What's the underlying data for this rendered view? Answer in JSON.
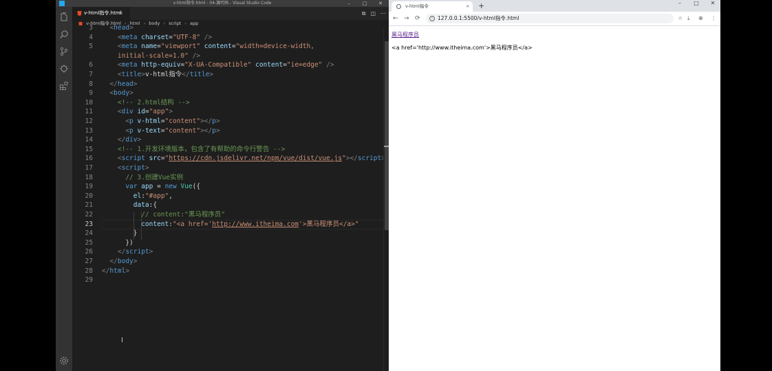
{
  "vscode": {
    "window_title": "v-html指令.html - 04-源代码 - Visual Studio Code",
    "window_controls": [
      "–",
      "□",
      "✕"
    ],
    "activity_icons": [
      "explorer-icon",
      "search-icon",
      "source-control-icon",
      "debug-icon",
      "extensions-icon"
    ],
    "settings_icon": "gear-icon",
    "tab": {
      "name": "v-html指令.html",
      "close": "×"
    },
    "tab_actions": [
      "⧉",
      "◫",
      "⋯"
    ],
    "breadcrumb": [
      "v-html指令.html",
      "html",
      "body",
      "script",
      "app"
    ],
    "breadcrumb_sep": "›",
    "lines": [
      {
        "n": "3",
        "tokens": [
          [
            "t-punct",
            "  <"
          ],
          [
            "t-tag",
            "head"
          ],
          [
            "t-punct",
            ">"
          ]
        ]
      },
      {
        "n": "4",
        "tokens": [
          [
            "t-punct",
            "    <"
          ],
          [
            "t-tag",
            "meta"
          ],
          [
            "t-text",
            " "
          ],
          [
            "t-attr",
            "charset"
          ],
          [
            "t-text",
            "="
          ],
          [
            "t-str",
            "\"UTF-8\""
          ],
          [
            "t-text",
            " "
          ],
          [
            "t-punct",
            "/>"
          ]
        ]
      },
      {
        "n": "5",
        "tokens": [
          [
            "t-punct",
            "    <"
          ],
          [
            "t-tag",
            "meta"
          ],
          [
            "t-text",
            " "
          ],
          [
            "t-attr",
            "name"
          ],
          [
            "t-text",
            "="
          ],
          [
            "t-str",
            "\"viewport\""
          ],
          [
            "t-text",
            " "
          ],
          [
            "t-attr",
            "content"
          ],
          [
            "t-text",
            "="
          ],
          [
            "t-str",
            "\"width=device-width,"
          ]
        ]
      },
      {
        "n": "",
        "tokens": [
          [
            "t-str",
            "    initial-scale=1.0\""
          ],
          [
            "t-text",
            " "
          ],
          [
            "t-punct",
            "/>"
          ]
        ]
      },
      {
        "n": "6",
        "tokens": [
          [
            "t-punct",
            "    <"
          ],
          [
            "t-tag",
            "meta"
          ],
          [
            "t-text",
            " "
          ],
          [
            "t-attr",
            "http-equiv"
          ],
          [
            "t-text",
            "="
          ],
          [
            "t-str",
            "\"X-UA-Compatible\""
          ],
          [
            "t-text",
            " "
          ],
          [
            "t-attr",
            "content"
          ],
          [
            "t-text",
            "="
          ],
          [
            "t-str",
            "\"ie=edge\""
          ],
          [
            "t-text",
            " "
          ],
          [
            "t-punct",
            "/>"
          ]
        ]
      },
      {
        "n": "7",
        "tokens": [
          [
            "t-punct",
            "    <"
          ],
          [
            "t-tag",
            "title"
          ],
          [
            "t-punct",
            ">"
          ],
          [
            "t-text",
            "v-html指令"
          ],
          [
            "t-punct",
            "</"
          ],
          [
            "t-tag",
            "title"
          ],
          [
            "t-punct",
            ">"
          ]
        ]
      },
      {
        "n": "8",
        "tokens": [
          [
            "t-punct",
            "  </"
          ],
          [
            "t-tag",
            "head"
          ],
          [
            "t-punct",
            ">"
          ]
        ]
      },
      {
        "n": "9",
        "tokens": [
          [
            "t-punct",
            "  <"
          ],
          [
            "t-tag",
            "body"
          ],
          [
            "t-punct",
            ">"
          ]
        ]
      },
      {
        "n": "10",
        "tokens": [
          [
            "t-com",
            "    <!-- 2.html结构 -->"
          ]
        ]
      },
      {
        "n": "11",
        "tokens": [
          [
            "t-punct",
            "    <"
          ],
          [
            "t-tag",
            "div"
          ],
          [
            "t-text",
            " "
          ],
          [
            "t-attr",
            "id"
          ],
          [
            "t-text",
            "="
          ],
          [
            "t-str",
            "\"app\""
          ],
          [
            "t-punct",
            ">"
          ]
        ]
      },
      {
        "n": "12",
        "tokens": [
          [
            "t-punct",
            "      <"
          ],
          [
            "t-tag",
            "p"
          ],
          [
            "t-text",
            " "
          ],
          [
            "t-attr",
            "v-html"
          ],
          [
            "t-text",
            "="
          ],
          [
            "t-str",
            "\"content\""
          ],
          [
            "t-punct",
            "></"
          ],
          [
            "t-tag",
            "p"
          ],
          [
            "t-punct",
            ">"
          ]
        ]
      },
      {
        "n": "13",
        "tokens": [
          [
            "t-punct",
            "      <"
          ],
          [
            "t-tag",
            "p"
          ],
          [
            "t-text",
            " "
          ],
          [
            "t-attr",
            "v-text"
          ],
          [
            "t-text",
            "="
          ],
          [
            "t-str",
            "\"content\""
          ],
          [
            "t-punct",
            "></"
          ],
          [
            "t-tag",
            "p"
          ],
          [
            "t-punct",
            ">"
          ]
        ]
      },
      {
        "n": "14",
        "tokens": [
          [
            "t-punct",
            "    </"
          ],
          [
            "t-tag",
            "div"
          ],
          [
            "t-punct",
            ">"
          ]
        ]
      },
      {
        "n": "15",
        "tokens": [
          [
            "t-com",
            "    <!-- 1.开发环境版本，包含了有帮助的命令行警告 -->"
          ]
        ]
      },
      {
        "n": "16",
        "tokens": [
          [
            "t-punct",
            "    <"
          ],
          [
            "t-tag",
            "script"
          ],
          [
            "t-text",
            " "
          ],
          [
            "t-attr",
            "src"
          ],
          [
            "t-text",
            "="
          ],
          [
            "t-str",
            "\""
          ],
          [
            "t-url",
            "https://cdn.jsdelivr.net/npm/vue/dist/vue.js"
          ],
          [
            "t-str",
            "\""
          ],
          [
            "t-punct",
            "></"
          ],
          [
            "t-tag",
            "script"
          ],
          [
            "t-punct",
            ">"
          ]
        ]
      },
      {
        "n": "17",
        "tokens": [
          [
            "t-punct",
            "    <"
          ],
          [
            "t-tag",
            "script"
          ],
          [
            "t-punct",
            ">"
          ]
        ]
      },
      {
        "n": "18",
        "tokens": [
          [
            "t-com",
            "      // 3.创建Vue实例"
          ]
        ]
      },
      {
        "n": "19",
        "tokens": [
          [
            "t-text",
            "      "
          ],
          [
            "t-kw",
            "var"
          ],
          [
            "t-text",
            " "
          ],
          [
            "t-attr",
            "app"
          ],
          [
            "t-text",
            " = "
          ],
          [
            "t-kw",
            "new"
          ],
          [
            "t-text",
            " "
          ],
          [
            "t-fn",
            "Vue"
          ],
          [
            "t-text",
            "({"
          ]
        ]
      },
      {
        "n": "20",
        "tokens": [
          [
            "t-text",
            "        "
          ],
          [
            "t-attr",
            "el"
          ],
          [
            "t-text",
            ":"
          ],
          [
            "t-str",
            "\"#app\""
          ],
          [
            "t-text",
            ","
          ]
        ]
      },
      {
        "n": "21",
        "tokens": [
          [
            "t-text",
            "        "
          ],
          [
            "t-attr",
            "data"
          ],
          [
            "t-text",
            ":{"
          ]
        ]
      },
      {
        "n": "22",
        "tokens": [
          [
            "t-com",
            "          // content:\"黑马程序员\""
          ]
        ]
      },
      {
        "n": "23",
        "tokens": [
          [
            "t-text",
            "          "
          ],
          [
            "t-attr",
            "content"
          ],
          [
            "t-text",
            ":"
          ],
          [
            "t-str",
            "\"<a href='"
          ],
          [
            "t-url",
            "http://www.itheima.com"
          ],
          [
            "t-str",
            "'>黑马程序员</a>\""
          ]
        ]
      },
      {
        "n": "24",
        "tokens": [
          [
            "t-text",
            "        }"
          ]
        ]
      },
      {
        "n": "25",
        "tokens": [
          [
            "t-text",
            "      })"
          ]
        ]
      },
      {
        "n": "26",
        "tokens": [
          [
            "t-punct",
            "    </"
          ],
          [
            "t-tag",
            "script"
          ],
          [
            "t-punct",
            ">"
          ]
        ]
      },
      {
        "n": "27",
        "tokens": [
          [
            "t-punct",
            "  </"
          ],
          [
            "t-tag",
            "body"
          ],
          [
            "t-punct",
            ">"
          ]
        ]
      },
      {
        "n": "28",
        "tokens": [
          [
            "t-punct",
            "</"
          ],
          [
            "t-tag",
            "html"
          ],
          [
            "t-punct",
            ">"
          ]
        ]
      },
      {
        "n": "29",
        "tokens": []
      }
    ],
    "active_line": "23"
  },
  "browser": {
    "tab_title": "v-html指令",
    "tab_close": "×",
    "new_tab": "+",
    "window_controls": [
      "–",
      "□",
      "✕"
    ],
    "nav": {
      "back": "←",
      "forward": "→",
      "reload": "⟳"
    },
    "url": "127.0.0.1:5500/v-html指令.html",
    "info_icon": "i",
    "extensions": [
      "☆",
      "⤓",
      "⊕",
      "⋮"
    ],
    "page": {
      "link_text": "黑马程序员",
      "raw_text": "<a href='http://www.itheima.com'>黑马程序员</a>"
    }
  },
  "colors": {
    "editor_bg": "#1e1e1e",
    "activity_bar": "#333333",
    "tag": "#569cd6",
    "attr": "#9cdcfe",
    "string": "#ce9178",
    "comment": "#6a9955",
    "link_visited": "#551a8b"
  }
}
